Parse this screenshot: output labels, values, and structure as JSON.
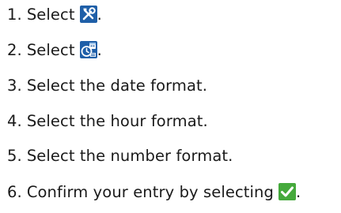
{
  "steps": [
    {
      "number": "1.",
      "text": "Select",
      "icon": "wrench-screwdriver-settings-icon",
      "end": "."
    },
    {
      "number": "2.",
      "text": "Select",
      "icon": "clock-calendar-settings-icon",
      "end": "."
    },
    {
      "number": "3.",
      "text": "Select the date format."
    },
    {
      "number": "4.",
      "text": "Select the hour format."
    },
    {
      "number": "5.",
      "text": "Select the number format."
    },
    {
      "number": "6.",
      "text": "Confirm your entry by selecting",
      "icon": "confirm-checkmark-icon",
      "end": "."
    }
  ],
  "colors": {
    "text": "#1a1a1a",
    "icon_blue": "#1f5fa8",
    "confirm_green": "#45a93c"
  }
}
